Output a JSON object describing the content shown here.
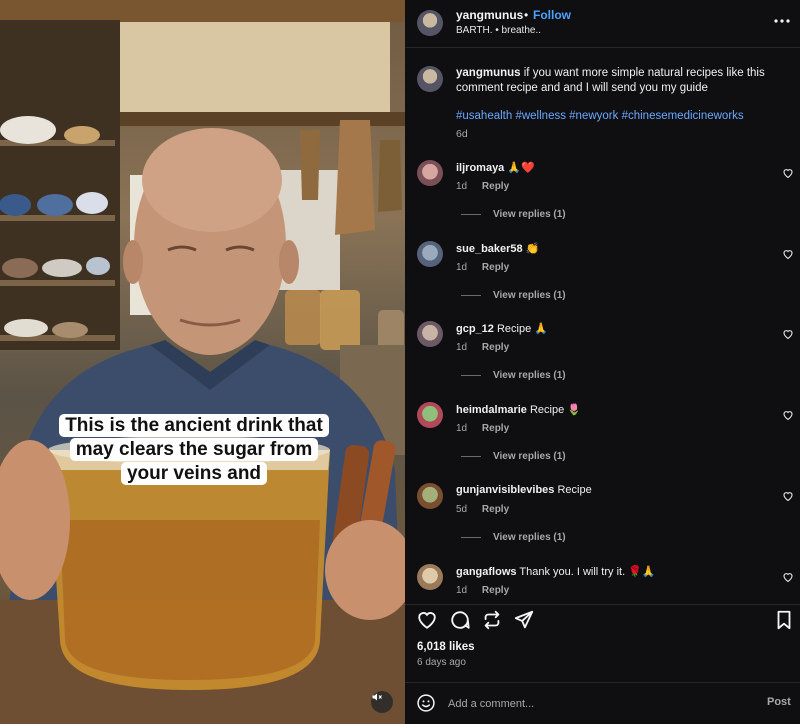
{
  "video": {
    "caption": "This is the ancient drink that may clears the sugar from your veins and",
    "mute_icon": "speaker-muted-icon"
  },
  "header": {
    "username": "yangmunus",
    "separator": "•",
    "follow_label": "Follow",
    "audio": "BARTH. • breathe..",
    "more_icon": "more-horizontal-icon",
    "follow_color": "#4aa3ff"
  },
  "post_caption": {
    "username": "yangmunus",
    "text": "if you want more simple natural recipes like this comment recipe and and I will send you my guide",
    "hashtags": "#usahealth #wellness #newyork #chinesemedicineworks",
    "time": "6d"
  },
  "comments": [
    {
      "username": "iljromaya",
      "text": "🙏❤️",
      "time": "1d",
      "reply_label": "Reply",
      "view_replies": "View replies (1)"
    },
    {
      "username": "sue_baker58",
      "text": "👏",
      "time": "1d",
      "reply_label": "Reply",
      "view_replies": "View replies (1)"
    },
    {
      "username": "gcp_12",
      "text": "Recipe 🙏",
      "time": "1d",
      "reply_label": "Reply",
      "view_replies": "View replies (1)"
    },
    {
      "username": "heimdalmarie",
      "text": "Recipe 🌷",
      "time": "1d",
      "reply_label": "Reply",
      "view_replies": "View replies (1)"
    },
    {
      "username": "gunjanvisiblevibes",
      "text": "Recipe",
      "time": "5d",
      "reply_label": "Reply",
      "view_replies": "View replies (1)"
    },
    {
      "username": "gangaflows",
      "text": "Thank you. I will try it. 🌹🙏",
      "time": "1d",
      "reply_label": "Reply"
    }
  ],
  "actions": {
    "like_icon": "heart-icon",
    "comment_icon": "comment-icon",
    "repost_icon": "repost-icon",
    "share_icon": "send-icon",
    "save_icon": "bookmark-icon"
  },
  "likes": "6,018 likes",
  "posted_ago": "6 days ago",
  "add_comment": {
    "placeholder": "Add a comment...",
    "post_label": "Post",
    "emoji_icon": "emoji-icon"
  }
}
